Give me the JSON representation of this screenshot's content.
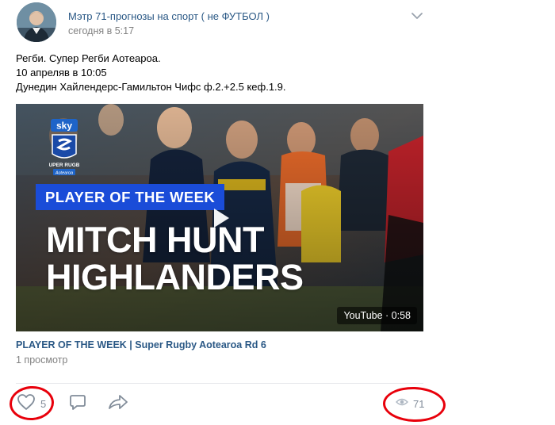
{
  "post": {
    "author": "Мэтр 71-прогнозы на спорт ( не ФУТБОЛ )",
    "date": "сегодня в 5:17",
    "text_lines": [
      "Регби. Супер Регби Аотеароа.",
      "10 апреляв в 10:05",
      "Дунедин Хайлендерс-Гамильтон Чифс ф.2.+2.5 кеф.1.9."
    ]
  },
  "video": {
    "overlay_banner": "PLAYER OF THE WEEK",
    "overlay_line1": "MITCH HUNT",
    "overlay_line2": "HIGHLANDERS",
    "logo_text_top": "sky",
    "logo_text_bottom": "SUPER RUGBY",
    "logo_text_sub": "Aotearoa",
    "badge": "YouTube · 0:58",
    "title": "PLAYER OF THE WEEK | Super Rugby Aotearoa Rd 6",
    "views": "1 просмотр"
  },
  "actions": {
    "like_count": "5",
    "views_count": "71"
  },
  "icons": {
    "avatar": "avatar-photo",
    "chevron": "chevron-down-icon",
    "play": "play-icon",
    "like": "heart-icon",
    "comment": "comment-icon",
    "share": "share-arrow-icon",
    "views": "eye-icon"
  },
  "colors": {
    "link": "#2a5885",
    "meta": "#828282",
    "icon": "#818c99",
    "banner": "#1a4cd8",
    "annotation": "#e8000b"
  }
}
